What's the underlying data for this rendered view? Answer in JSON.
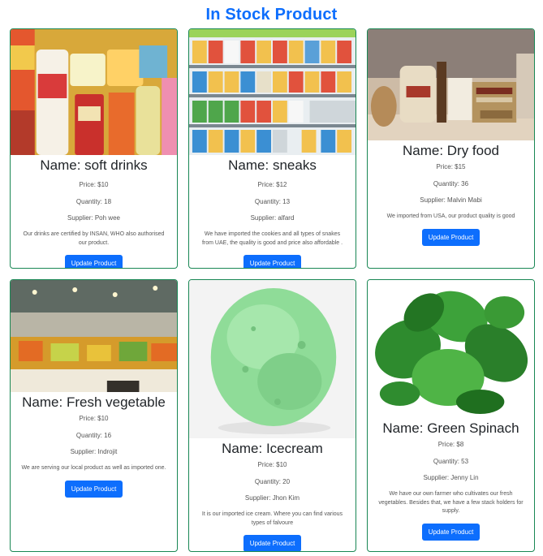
{
  "page": {
    "title": "In Stock Product"
  },
  "labels": {
    "name_prefix": "Name: ",
    "price_prefix": "Price: ",
    "quantity_prefix": "Quantity: ",
    "supplier_prefix": "Supplier: "
  },
  "colors": {
    "accent": "#0d6efd",
    "card_border": "#198754",
    "button": "#0d6efd"
  },
  "products": [
    {
      "name": "soft drinks",
      "price": "$10",
      "quantity": "18",
      "supplier": "Poh wee",
      "description": "Our drinks are certified by INSAN, WHO also authorised our product.",
      "button": "Update Product",
      "image": "soft-drinks-image"
    },
    {
      "name": "sneaks",
      "price": "$12",
      "quantity": "13",
      "supplier": "alfard",
      "description": "We have imported the cookies and all types of snakes from UAE, the quality is good and price also affordable .",
      "button": "Update Product",
      "image": "snacks-shelf-image"
    },
    {
      "name": "Dry food",
      "price": "$15",
      "quantity": "36",
      "supplier": "Malvin Mabi",
      "description": "We imported from USA, our product quality is good",
      "button": "Update Product",
      "image": "dry-food-image"
    },
    {
      "name": "Fresh vegetable",
      "price": "$10",
      "quantity": "16",
      "supplier": "Indrojit",
      "description": "We are serving our local product as well as imported one.",
      "button": "Update Product",
      "image": "vegetable-market-image"
    },
    {
      "name": "Icecream",
      "price": "$10",
      "quantity": "20",
      "supplier": "Jhon Kim",
      "description": "It is our imported ice cream. Where you can find various types of falvoure",
      "button": "Update Product",
      "image": "ice-cream-scoop-image"
    },
    {
      "name": "Green Spinach",
      "price": "$8",
      "quantity": "53",
      "supplier": "Jenny Lin",
      "description": "We have our own farmer who cultivates our fresh vegetables. Besides that, we have a few stack holders for supply.",
      "button": "Update Product",
      "image": "spinach-image"
    }
  ]
}
